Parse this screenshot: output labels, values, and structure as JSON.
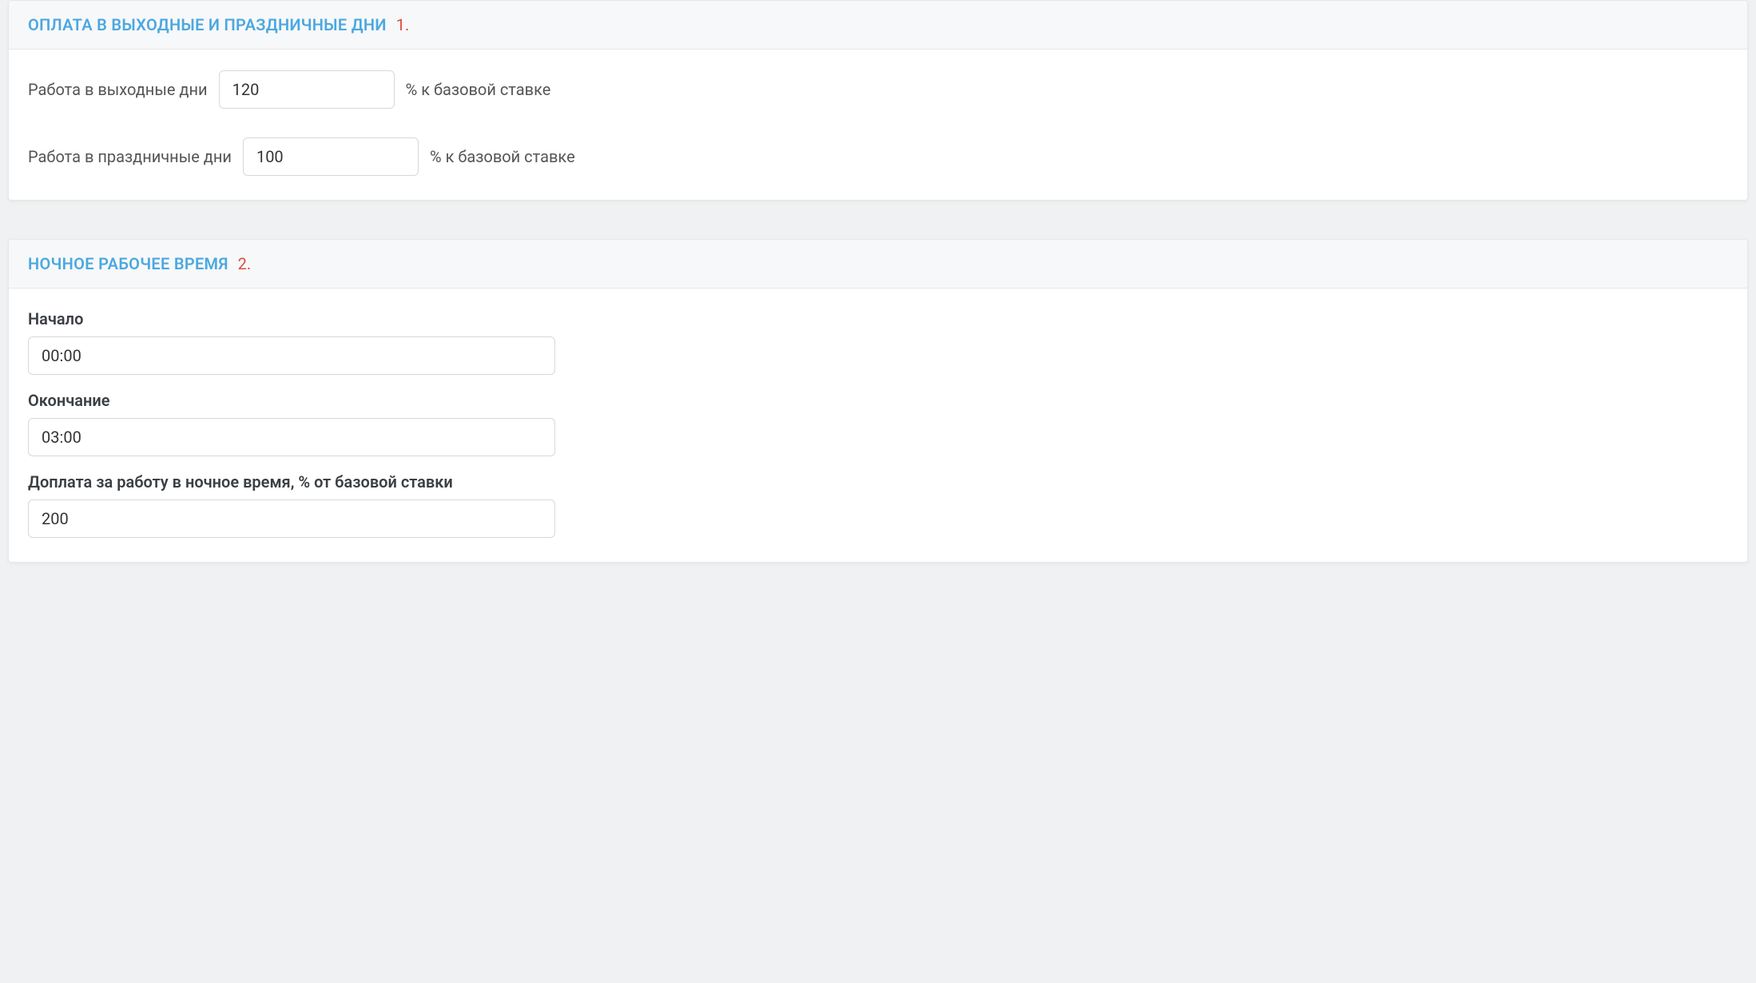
{
  "panel1": {
    "title": "ОПЛАТА В ВЫХОДНЫЕ И ПРАЗДНИЧНЫЕ ДНИ",
    "annotation": "1.",
    "rows": {
      "weekend": {
        "label": "Работа в выходные дни",
        "value": "120",
        "suffix": "% к базовой ставке"
      },
      "holiday": {
        "label": "Работа в праздничные дни",
        "value": "100",
        "suffix": "% к базовой ставке"
      }
    }
  },
  "panel2": {
    "title": "НОЧНОЕ РАБОЧЕЕ ВРЕМЯ",
    "annotation": "2.",
    "fields": {
      "start": {
        "label": "Начало",
        "value": "00:00"
      },
      "end": {
        "label": "Окончание",
        "value": "03:00"
      },
      "surcharge": {
        "label": "Доплата за работу в ночное время, % от базовой ставки",
        "value": "200"
      }
    }
  }
}
